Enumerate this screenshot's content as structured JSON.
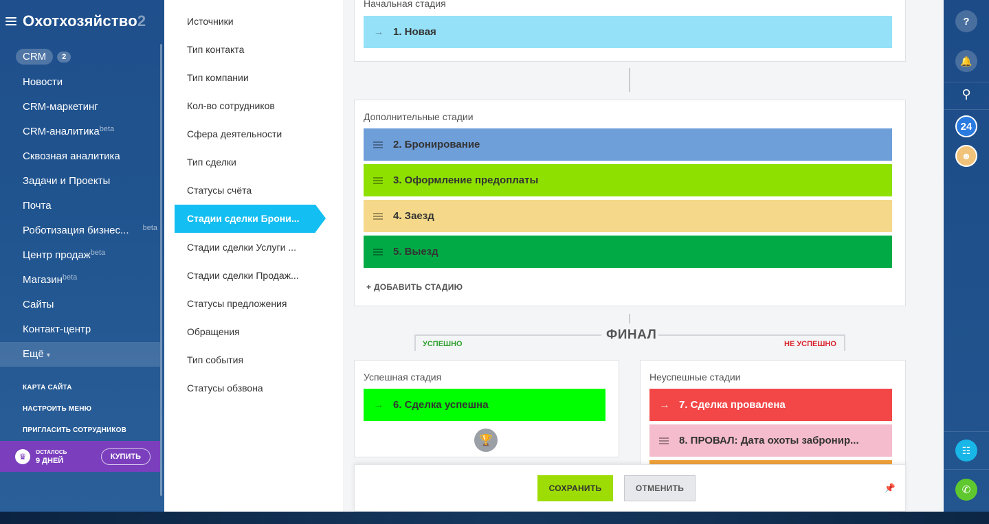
{
  "sidebar": {
    "title": "Охотхозяйство",
    "title_tail": "2",
    "crm_label": "CRM",
    "crm_count": "2",
    "items": [
      {
        "label": "Новости",
        "beta": ""
      },
      {
        "label": "CRM-маркетинг",
        "beta": ""
      },
      {
        "label": "CRM-аналитика",
        "beta": "beta"
      },
      {
        "label": "Сквозная аналитика",
        "beta": ""
      },
      {
        "label": "Задачи и Проекты",
        "beta": ""
      },
      {
        "label": "Почта",
        "beta": ""
      },
      {
        "label": "Роботизация бизнес...",
        "beta": "beta"
      },
      {
        "label": "Центр продаж",
        "beta": "beta"
      },
      {
        "label": "Магазин",
        "beta": "beta"
      },
      {
        "label": "Сайты",
        "beta": ""
      },
      {
        "label": "Контакт-центр",
        "beta": ""
      },
      {
        "label": "Ещё",
        "beta": ""
      }
    ],
    "links": [
      "КАРТА САЙТА",
      "НАСТРОИТЬ МЕНЮ",
      "ПРИГЛАСИТЬ СОТРУДНИКОВ"
    ],
    "trial_small": "ОСТАЛОСЬ",
    "trial_days": "9 ДНЕЙ",
    "buy_label": "КУПИТЬ"
  },
  "settings_menu": {
    "items": [
      "Источники",
      "Тип контакта",
      "Тип компании",
      "Кол-во сотрудников",
      "Сфера деятельности",
      "Тип сделки",
      "Статусы счёта",
      "Стадии сделки Брони...",
      "Стадии сделки Услуги ...",
      "Стадии сделки Продаж...",
      "Статусы предложения",
      "Обращения",
      "Тип события",
      "Статусы обзвона"
    ],
    "active_index": 7
  },
  "main": {
    "initial_label": "Начальная стадия",
    "initial_stage": {
      "label": "1. Новая",
      "color": "#95e1f8"
    },
    "additional_label": "Дополнительные стадии",
    "additional_stages": [
      {
        "label": "2. Бронирование",
        "color": "#6f9fd9"
      },
      {
        "label": "3. Оформление предоплаты",
        "color": "#8ee000"
      },
      {
        "label": "4. Заезд",
        "color": "#f5d889"
      },
      {
        "label": "5. Выезд",
        "color": "#02aa45"
      }
    ],
    "add_stage": "+ ДОБАВИТЬ СТАДИЮ",
    "final_title": "ФИНАЛ",
    "final_success": "УСПЕШНО",
    "final_fail": "НЕ УСПЕШНО",
    "success_label": "Успешная стадия",
    "success_stage": {
      "label": "6. Сделка успешна",
      "color": "#00ff00"
    },
    "fail_label": "Неуспешные стадии",
    "fail_stages": [
      {
        "label": "7. Сделка провалена",
        "color": "#f34747"
      },
      {
        "label": "8. ПРОВАЛ: Дата охоты забронир...",
        "color": "#f4bccc"
      }
    ],
    "fail_peek_color": "#f0a33b"
  },
  "footer": {
    "save_label": "СОХРАНИТЬ",
    "cancel_label": "ОТМЕНИТЬ"
  },
  "rightbar": {
    "help": "?",
    "b24": "24"
  }
}
